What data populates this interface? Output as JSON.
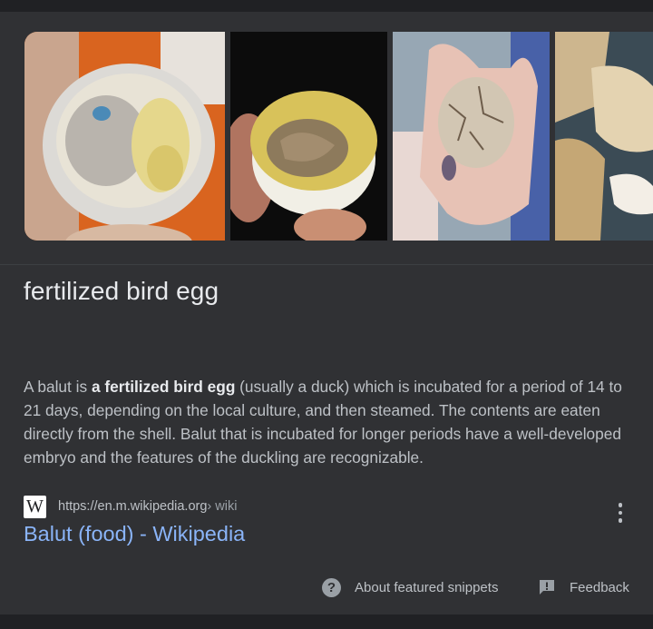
{
  "gallery": {
    "images": [
      {
        "icon": "balut-embryo-photo"
      },
      {
        "icon": "balut-yolk-photo"
      },
      {
        "icon": "cracked-egg-in-hand-photo"
      },
      {
        "icon": "egg-shells-photo"
      }
    ]
  },
  "answer": {
    "title": "fertilized bird egg"
  },
  "snippet": {
    "before": "A balut is ",
    "bold": "a fertilized bird egg",
    "after": " (usually a duck) which is incubated for a period of 14 to 21 days, depending on the local culture, and then steamed. The contents are eaten directly from the shell. Balut that is incubated for longer periods have a well-developed embryo and the features of the duckling are recognizable."
  },
  "source": {
    "logo_text": "W",
    "url": "https://en.m.wikipedia.org",
    "breadcrumb": " › wiki",
    "title": "Balut (food) - Wikipedia"
  },
  "footer": {
    "about_label": "About featured snippets",
    "feedback_label": "Feedback",
    "help_glyph": "?"
  },
  "colors": {
    "background": "#303134",
    "link": "#8ab4f8",
    "text": "#bdc1c6"
  }
}
